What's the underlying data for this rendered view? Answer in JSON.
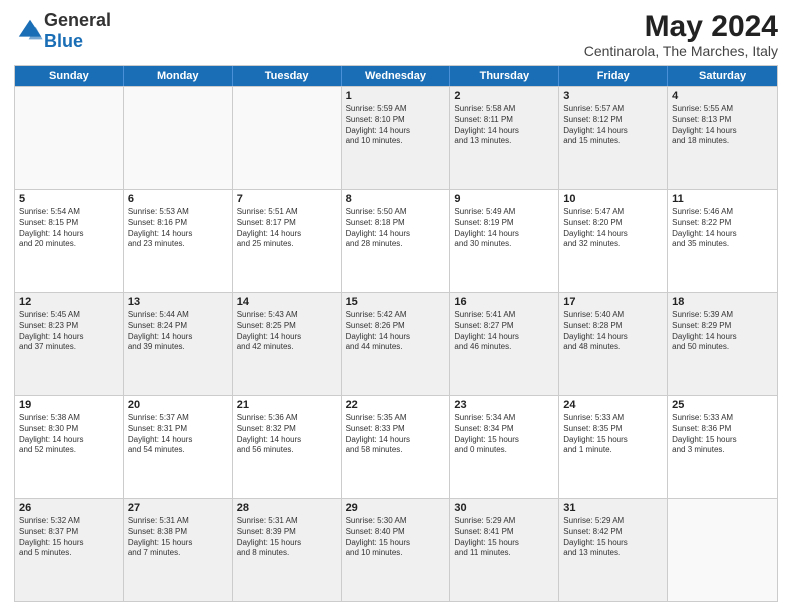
{
  "logo": {
    "general": "General",
    "blue": "Blue"
  },
  "title": {
    "month": "May 2024",
    "location": "Centinarola, The Marches, Italy"
  },
  "header_days": [
    "Sunday",
    "Monday",
    "Tuesday",
    "Wednesday",
    "Thursday",
    "Friday",
    "Saturday"
  ],
  "rows": [
    [
      {
        "day": "",
        "info": ""
      },
      {
        "day": "",
        "info": ""
      },
      {
        "day": "",
        "info": ""
      },
      {
        "day": "1",
        "info": "Sunrise: 5:59 AM\nSunset: 8:10 PM\nDaylight: 14 hours\nand 10 minutes."
      },
      {
        "day": "2",
        "info": "Sunrise: 5:58 AM\nSunset: 8:11 PM\nDaylight: 14 hours\nand 13 minutes."
      },
      {
        "day": "3",
        "info": "Sunrise: 5:57 AM\nSunset: 8:12 PM\nDaylight: 14 hours\nand 15 minutes."
      },
      {
        "day": "4",
        "info": "Sunrise: 5:55 AM\nSunset: 8:13 PM\nDaylight: 14 hours\nand 18 minutes."
      }
    ],
    [
      {
        "day": "5",
        "info": "Sunrise: 5:54 AM\nSunset: 8:15 PM\nDaylight: 14 hours\nand 20 minutes."
      },
      {
        "day": "6",
        "info": "Sunrise: 5:53 AM\nSunset: 8:16 PM\nDaylight: 14 hours\nand 23 minutes."
      },
      {
        "day": "7",
        "info": "Sunrise: 5:51 AM\nSunset: 8:17 PM\nDaylight: 14 hours\nand 25 minutes."
      },
      {
        "day": "8",
        "info": "Sunrise: 5:50 AM\nSunset: 8:18 PM\nDaylight: 14 hours\nand 28 minutes."
      },
      {
        "day": "9",
        "info": "Sunrise: 5:49 AM\nSunset: 8:19 PM\nDaylight: 14 hours\nand 30 minutes."
      },
      {
        "day": "10",
        "info": "Sunrise: 5:47 AM\nSunset: 8:20 PM\nDaylight: 14 hours\nand 32 minutes."
      },
      {
        "day": "11",
        "info": "Sunrise: 5:46 AM\nSunset: 8:22 PM\nDaylight: 14 hours\nand 35 minutes."
      }
    ],
    [
      {
        "day": "12",
        "info": "Sunrise: 5:45 AM\nSunset: 8:23 PM\nDaylight: 14 hours\nand 37 minutes."
      },
      {
        "day": "13",
        "info": "Sunrise: 5:44 AM\nSunset: 8:24 PM\nDaylight: 14 hours\nand 39 minutes."
      },
      {
        "day": "14",
        "info": "Sunrise: 5:43 AM\nSunset: 8:25 PM\nDaylight: 14 hours\nand 42 minutes."
      },
      {
        "day": "15",
        "info": "Sunrise: 5:42 AM\nSunset: 8:26 PM\nDaylight: 14 hours\nand 44 minutes."
      },
      {
        "day": "16",
        "info": "Sunrise: 5:41 AM\nSunset: 8:27 PM\nDaylight: 14 hours\nand 46 minutes."
      },
      {
        "day": "17",
        "info": "Sunrise: 5:40 AM\nSunset: 8:28 PM\nDaylight: 14 hours\nand 48 minutes."
      },
      {
        "day": "18",
        "info": "Sunrise: 5:39 AM\nSunset: 8:29 PM\nDaylight: 14 hours\nand 50 minutes."
      }
    ],
    [
      {
        "day": "19",
        "info": "Sunrise: 5:38 AM\nSunset: 8:30 PM\nDaylight: 14 hours\nand 52 minutes."
      },
      {
        "day": "20",
        "info": "Sunrise: 5:37 AM\nSunset: 8:31 PM\nDaylight: 14 hours\nand 54 minutes."
      },
      {
        "day": "21",
        "info": "Sunrise: 5:36 AM\nSunset: 8:32 PM\nDaylight: 14 hours\nand 56 minutes."
      },
      {
        "day": "22",
        "info": "Sunrise: 5:35 AM\nSunset: 8:33 PM\nDaylight: 14 hours\nand 58 minutes."
      },
      {
        "day": "23",
        "info": "Sunrise: 5:34 AM\nSunset: 8:34 PM\nDaylight: 15 hours\nand 0 minutes."
      },
      {
        "day": "24",
        "info": "Sunrise: 5:33 AM\nSunset: 8:35 PM\nDaylight: 15 hours\nand 1 minute."
      },
      {
        "day": "25",
        "info": "Sunrise: 5:33 AM\nSunset: 8:36 PM\nDaylight: 15 hours\nand 3 minutes."
      }
    ],
    [
      {
        "day": "26",
        "info": "Sunrise: 5:32 AM\nSunset: 8:37 PM\nDaylight: 15 hours\nand 5 minutes."
      },
      {
        "day": "27",
        "info": "Sunrise: 5:31 AM\nSunset: 8:38 PM\nDaylight: 15 hours\nand 7 minutes."
      },
      {
        "day": "28",
        "info": "Sunrise: 5:31 AM\nSunset: 8:39 PM\nDaylight: 15 hours\nand 8 minutes."
      },
      {
        "day": "29",
        "info": "Sunrise: 5:30 AM\nSunset: 8:40 PM\nDaylight: 15 hours\nand 10 minutes."
      },
      {
        "day": "30",
        "info": "Sunrise: 5:29 AM\nSunset: 8:41 PM\nDaylight: 15 hours\nand 11 minutes."
      },
      {
        "day": "31",
        "info": "Sunrise: 5:29 AM\nSunset: 8:42 PM\nDaylight: 15 hours\nand 13 minutes."
      },
      {
        "day": "",
        "info": ""
      }
    ]
  ]
}
